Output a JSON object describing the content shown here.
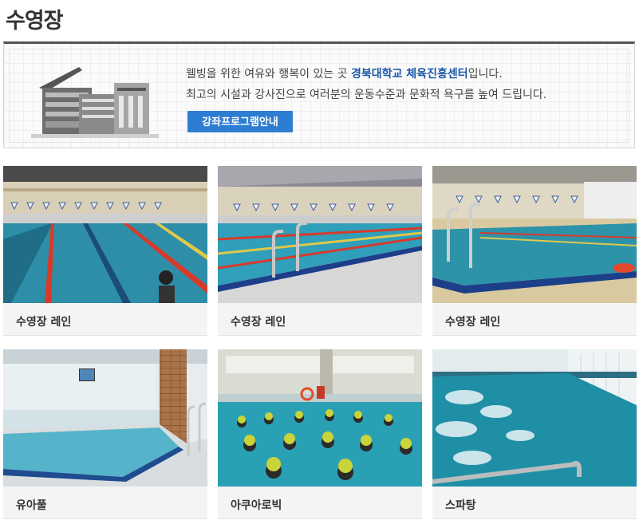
{
  "page": {
    "title": "수영장"
  },
  "intro": {
    "line1_prefix": "웰빙을 위한 여유와 행복이 있는 곳 ",
    "line1_highlight": "경북대학교 체육진흥센터",
    "line1_suffix": "입니다.",
    "line2": "최고의 시설과 강사진으로 여러분의 운동수준과 문화적 욕구를 높여 드립니다.",
    "button_label": "강좌프로그램안내"
  },
  "facilities": [
    {
      "caption": "수영장 레인"
    },
    {
      "caption": "수영장 레인"
    },
    {
      "caption": "수영장 레인"
    },
    {
      "caption": "유아풀"
    },
    {
      "caption": "아쿠아로빅"
    },
    {
      "caption": "스파탕"
    }
  ],
  "colors": {
    "accent": "#2d7dd2",
    "highlight": "#1d58a7",
    "pool": "#2e9bb4"
  }
}
